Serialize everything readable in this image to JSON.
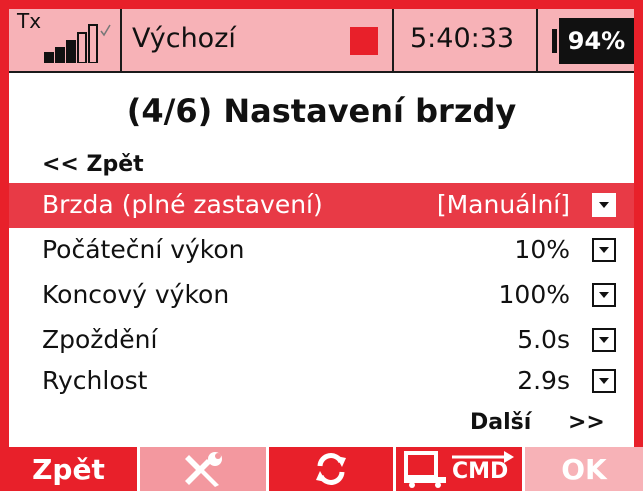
{
  "status_bar": {
    "tx_label": "Tx",
    "model_name": "Výchozí",
    "time": "5:40:33",
    "battery": "94%",
    "signal_bars": 5,
    "signal_icon": "signal-bars-icon",
    "record_indicator": "record-square-icon"
  },
  "colors": {
    "accent": "#e8202a",
    "status_bg": "#f7b2b7",
    "selected_row": "#e83a46",
    "disabled_key": "#f3989f"
  },
  "page": {
    "title": "(4/6) Nastavení brzdy",
    "back_link": "<< Zpět",
    "next_link": "Další",
    "next_arrows": ">>"
  },
  "menu": {
    "items": [
      {
        "label": "Brzda (plné zastavení)",
        "value": "[Manuální]",
        "selected": true
      },
      {
        "label": "Počáteční výkon",
        "value": "10%",
        "selected": false
      },
      {
        "label": "Koncový výkon",
        "value": "100%",
        "selected": false
      },
      {
        "label": "Zpoždění",
        "value": "5.0s",
        "selected": false
      },
      {
        "label": "Rychlost",
        "value": "2.9s",
        "selected": false
      }
    ]
  },
  "softkeys": {
    "back_label": "Zpět",
    "tool_icon": "wrench-screwdriver-icon",
    "refresh_icon": "refresh-icon",
    "cmd_label": "CMD",
    "cmd_icon": "truck-cmd-icon",
    "ok_label": "OK"
  }
}
